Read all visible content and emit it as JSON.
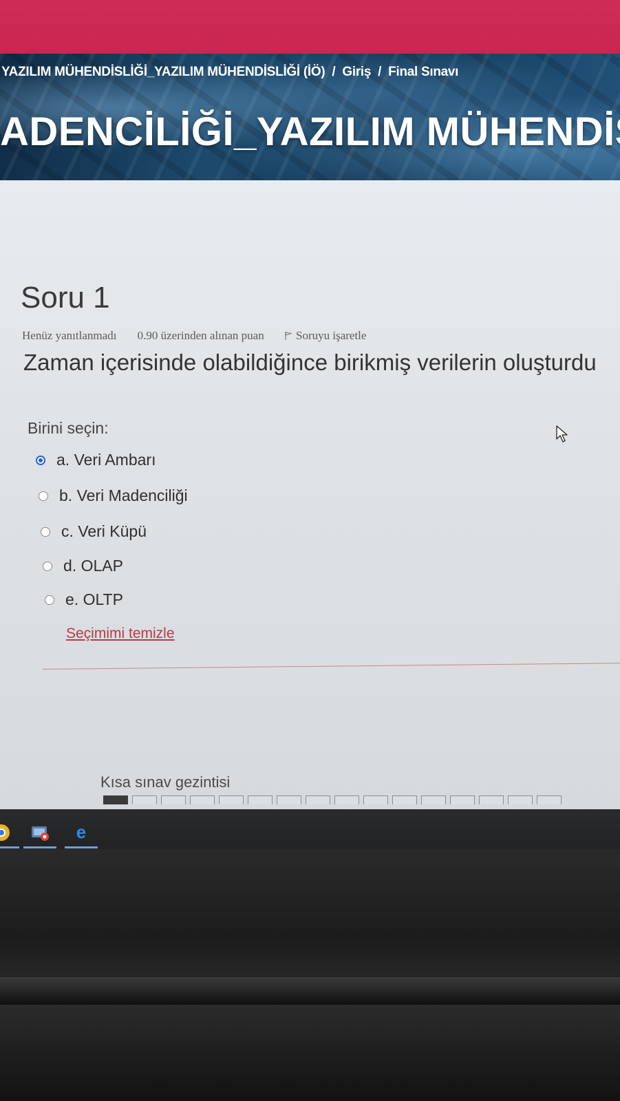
{
  "breadcrumb": {
    "course": "YAZILIM MÜHENDİSLİĞİ_YAZILIM MÜHENDİSLİĞİ (İÖ)",
    "separator": "/",
    "section": "Giriş",
    "page": "Final Sınavı"
  },
  "banner": {
    "title": "ADENCİLİĞİ_YAZILIM MÜHENDİS"
  },
  "question": {
    "title": "Soru 1",
    "status": "Henüz yanıtlanmadı",
    "points": "0.90 üzerinden alınan puan",
    "flag_label": "Soruyu işaretle",
    "text": "Zaman içerisinde olabildiğince birikmiş verilerin oluşturdu",
    "prompt": "Birini seçin:",
    "options": [
      {
        "label": "a. Veri Ambarı",
        "selected": true
      },
      {
        "label": "b. Veri Madenciliği",
        "selected": false
      },
      {
        "label": "c. Veri Küpü",
        "selected": false
      },
      {
        "label": "d. OLAP",
        "selected": false
      },
      {
        "label": "e. OLTP",
        "selected": false
      }
    ],
    "clear_label": "Seçimimi temizle"
  },
  "navigation": {
    "title": "Kısa sınav gezintisi"
  },
  "colors": {
    "header_pink": "#c5264f",
    "radio_selected": "#2b5fd9",
    "link_red": "#b53a4a"
  },
  "icons": {
    "flag": "flag-icon",
    "taskbar": [
      "chrome-icon",
      "media-icon",
      "edge-icon"
    ],
    "pointer": "mouse-cursor-icon"
  }
}
